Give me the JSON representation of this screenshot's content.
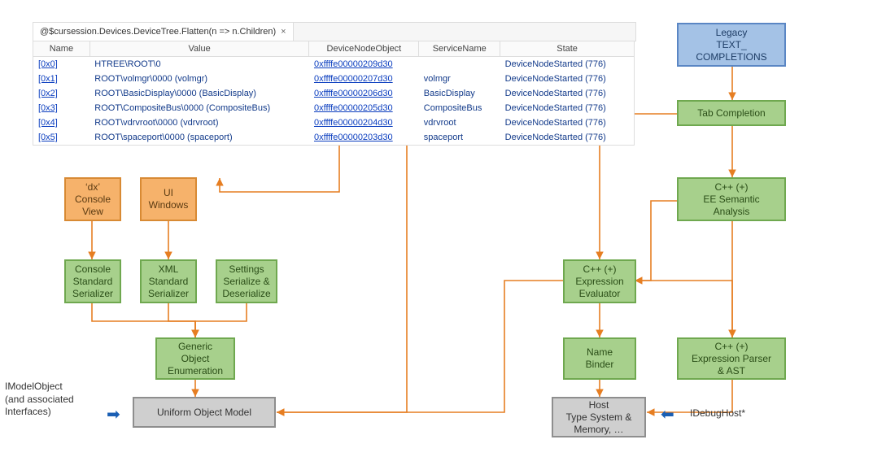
{
  "tab": {
    "title": "@$cursession.Devices.DeviceTree.Flatten(n => n.Children)",
    "close": "×"
  },
  "columns": [
    "Name",
    "Value",
    "DeviceNodeObject",
    "ServiceName",
    "State"
  ],
  "rows": [
    {
      "name": "[0x0]",
      "value": "HTREE\\ROOT\\0",
      "obj": "0xffffe00000209d30",
      "svc": "",
      "state": "DeviceNodeStarted (776)"
    },
    {
      "name": "[0x1]",
      "value": "ROOT\\volmgr\\0000 (volmgr)",
      "obj": "0xffffe00000207d30",
      "svc": "volmgr",
      "state": "DeviceNodeStarted (776)"
    },
    {
      "name": "[0x2]",
      "value": "ROOT\\BasicDisplay\\0000 (BasicDisplay)",
      "obj": "0xffffe00000206d30",
      "svc": "BasicDisplay",
      "state": "DeviceNodeStarted (776)"
    },
    {
      "name": "[0x3]",
      "value": "ROOT\\CompositeBus\\0000 (CompositeBus)",
      "obj": "0xffffe00000205d30",
      "svc": "CompositeBus",
      "state": "DeviceNodeStarted (776)"
    },
    {
      "name": "[0x4]",
      "value": "ROOT\\vdrvroot\\0000 (vdrvroot)",
      "obj": "0xffffe00000204d30",
      "svc": "vdrvroot",
      "state": "DeviceNodeStarted (776)"
    },
    {
      "name": "[0x5]",
      "value": "ROOT\\spaceport\\0000 (spaceport)",
      "obj": "0xffffe00000203d30",
      "svc": "spaceport",
      "state": "DeviceNodeStarted (776)"
    }
  ],
  "nodes": {
    "dx_console": "‘dx’\nConsole\nView",
    "ui_windows": "UI\nWindows",
    "console_ser": "Console\nStandard\nSerializer",
    "xml_ser": "XML\nStandard\nSerializer",
    "settings": "Settings\nSerialize &\nDeserialize",
    "generic_enum": "Generic\nObject\nEnumeration",
    "uom": "Uniform Object Model",
    "legacy": "Legacy\nTEXT_\nCOMPLETIONS",
    "tab_comp": "Tab Completion",
    "ee_semantic": "C++ (+)\nEE Semantic\nAnalysis",
    "expr_eval": "C++ (+)\nExpression\nEvaluator",
    "name_binder": "Name\nBinder",
    "parser_ast": "C++ (+)\nExpression Parser\n& AST",
    "host_ts": "Host\nType System &\nMemory, …"
  },
  "labels": {
    "imodel": "IModelObject\n(and associated\nInterfaces)",
    "idebug": "IDebugHost*"
  },
  "arrows": {
    "right": "➡",
    "left": "⬅"
  }
}
